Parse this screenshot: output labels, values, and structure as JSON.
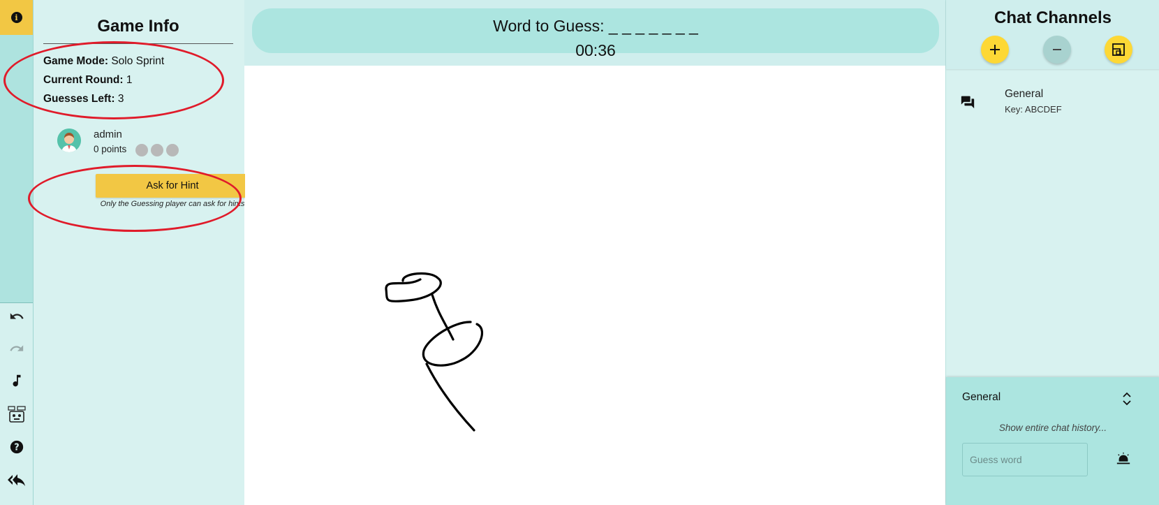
{
  "game_info": {
    "title": "Game Info",
    "mode_label": "Game Mode:",
    "mode_value": "Solo Sprint",
    "round_label": "Current Round:",
    "round_value": "1",
    "guesses_label": "Guesses Left:",
    "guesses_value": "3",
    "player": {
      "name": "admin",
      "points": "0 points"
    },
    "hint_button": "Ask for Hint",
    "hint_note": "Only the Guessing player can ask for hints"
  },
  "header": {
    "word": "Word to Guess: _ _ _ _ _ _ _",
    "timer": "00:36"
  },
  "chat": {
    "title": "Chat Channels",
    "channels": [
      {
        "name": "General",
        "key": "Key: ABCDEF"
      }
    ],
    "active_channel": "General",
    "history_link": "Show entire chat history...",
    "guess_placeholder": "Guess word"
  },
  "colors": {
    "accent_yellow": "#f2c744",
    "panel_teal": "#d8f2f0",
    "header_teal": "#ace5e0",
    "annotation_red": "#e01b2a"
  },
  "icons": {
    "rail": [
      "info-icon",
      "undo-icon",
      "redo-icon",
      "music-note-icon",
      "robot-icon",
      "help-icon",
      "reply-all-icon"
    ],
    "chat_header": [
      "add-icon",
      "remove-icon",
      "split-view-icon"
    ],
    "chat": [
      "forum-icon",
      "expand-icon",
      "bell-icon"
    ]
  }
}
